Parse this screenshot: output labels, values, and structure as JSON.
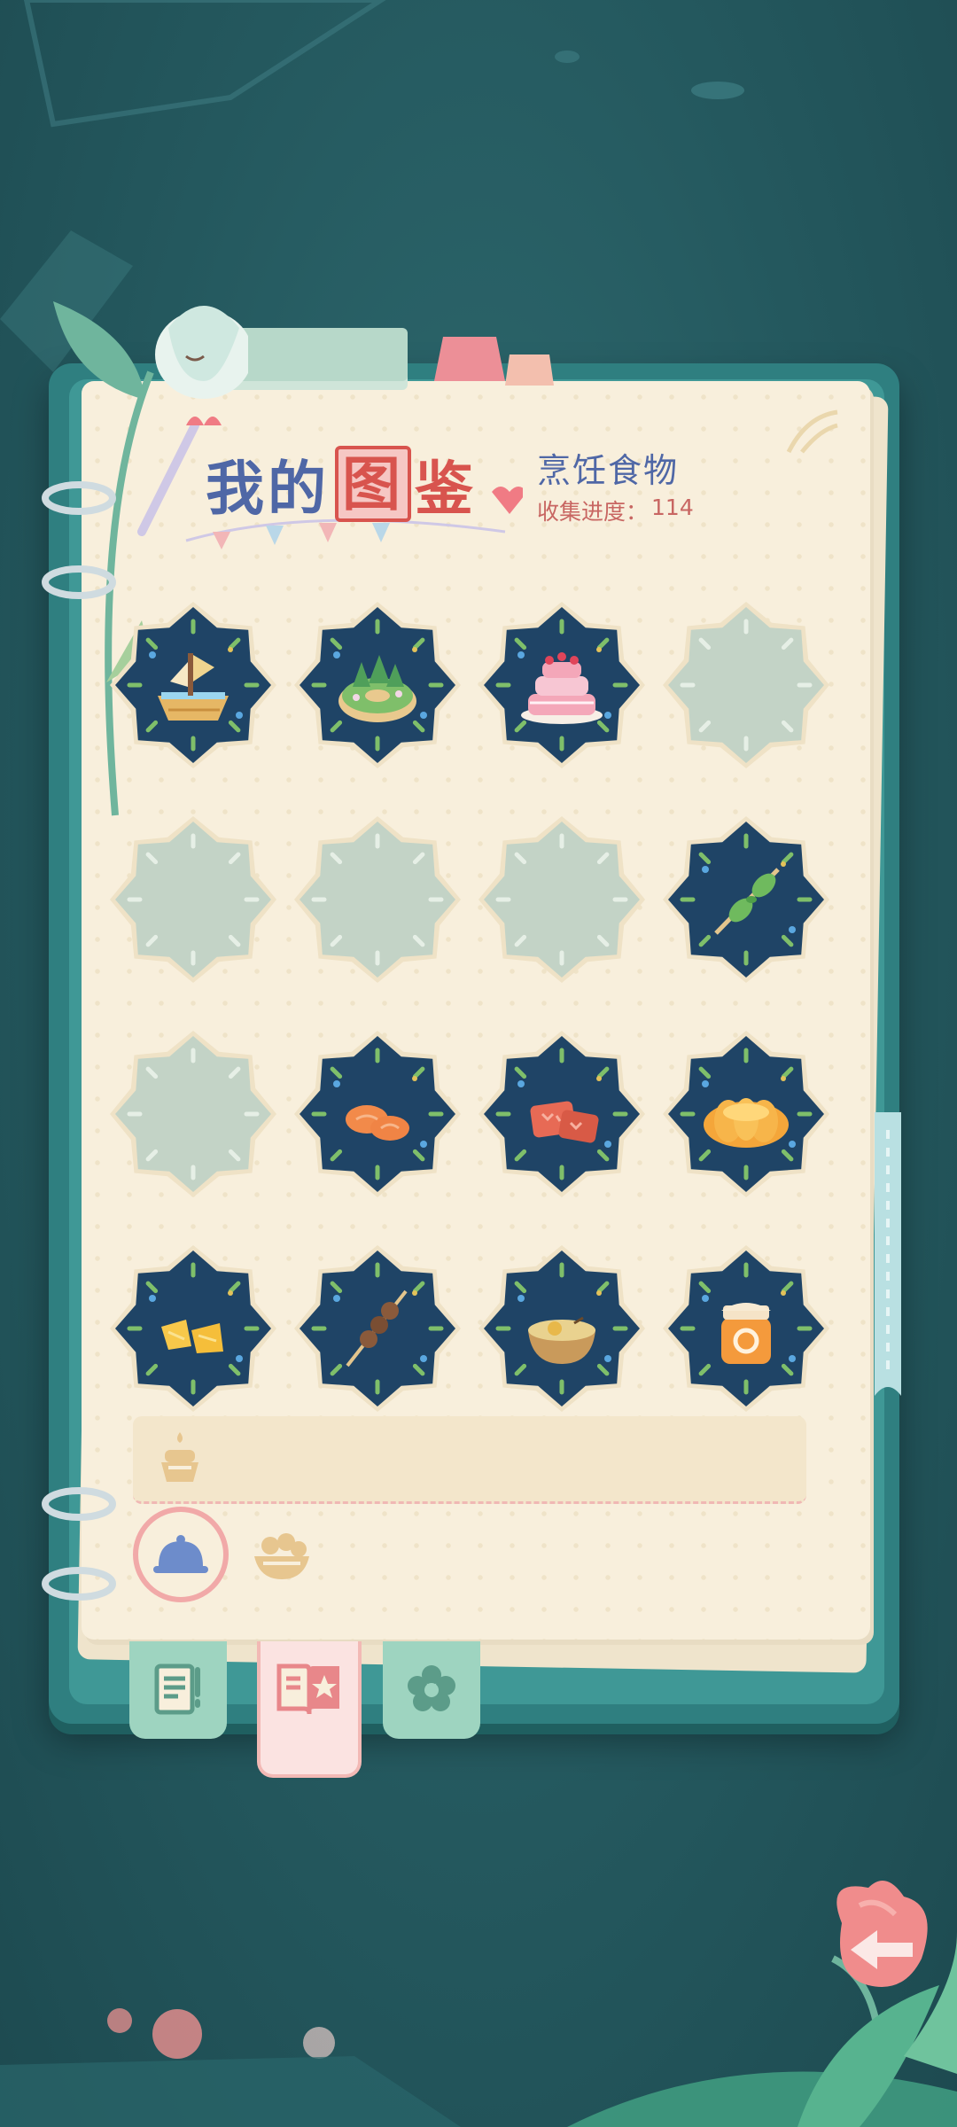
{
  "header": {
    "title_part1": "我的",
    "title_highlight": "图",
    "title_part2": "鉴",
    "category_label": "烹饪食物",
    "progress_label": "收集进度：",
    "progress_value": "114"
  },
  "collection_grid": {
    "rows": [
      [
        {
          "name": "boat-cake",
          "collected": true
        },
        {
          "name": "matcha-donut",
          "collected": true
        },
        {
          "name": "pink-layer-cake",
          "collected": true
        },
        {
          "name": "locked",
          "collected": false
        }
      ],
      [
        {
          "name": "locked",
          "collected": false
        },
        {
          "name": "locked",
          "collected": false
        },
        {
          "name": "locked",
          "collected": false
        },
        {
          "name": "herb-skewer",
          "collected": true
        }
      ],
      [
        {
          "name": "locked",
          "collected": false
        },
        {
          "name": "orange-cookies",
          "collected": true
        },
        {
          "name": "red-flower-cookies",
          "collected": true
        },
        {
          "name": "pumpkin-pie",
          "collected": true
        }
      ],
      [
        {
          "name": "yellow-candies",
          "collected": true
        },
        {
          "name": "meatball-skewer",
          "collected": true
        },
        {
          "name": "soup-bowl",
          "collected": true
        },
        {
          "name": "orange-jam-jar",
          "collected": true
        }
      ]
    ]
  },
  "colors": {
    "badge_dark": "#1f4466",
    "badge_locked": "#c3d3c6",
    "page": "#f8efdc",
    "accent_blue": "#4f67a6",
    "accent_red": "#d8544e",
    "tab_green": "#9ed4c0",
    "tab_pink": "#fbe3e1"
  },
  "icons": {
    "filter_cooked": "serving-cloche-icon",
    "filter_ingredients": "bread-basket-icon",
    "tray_item": "small-cake-icon",
    "tab_tasks": "note-icon",
    "tab_collection": "book-star-icon",
    "tab_flowers": "flower-icon",
    "back": "back-arrow-icon"
  }
}
